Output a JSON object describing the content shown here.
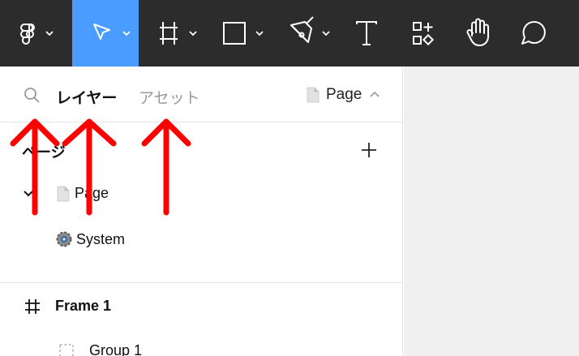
{
  "colors": {
    "toolbar_bg": "#2c2c2c",
    "accent": "#4a9cff",
    "annotation": "#ff0000"
  },
  "toolbar": {
    "items": [
      {
        "name": "figma-menu",
        "icon": "figma-logo-icon",
        "has_chevron": true
      },
      {
        "name": "move-tool",
        "icon": "cursor-icon",
        "has_chevron": true,
        "active": true
      },
      {
        "name": "frame-tool",
        "icon": "frame-hash-icon",
        "has_chevron": true
      },
      {
        "name": "shape-tool",
        "icon": "rectangle-icon",
        "has_chevron": true
      },
      {
        "name": "pen-tool",
        "icon": "pen-nib-icon",
        "has_chevron": true
      },
      {
        "name": "text-tool",
        "icon": "text-t-icon"
      },
      {
        "name": "resources-tool",
        "icon": "components-icon"
      },
      {
        "name": "hand-tool",
        "icon": "hand-icon"
      },
      {
        "name": "comment-tool",
        "icon": "comment-bubble-icon"
      }
    ]
  },
  "panel": {
    "tabs": {
      "layers": "レイヤー",
      "assets": "アセット"
    },
    "page_selector": {
      "label": "Page",
      "icon": "page-file-icon"
    },
    "pages_header": "ページ",
    "pages": [
      {
        "label": "Page",
        "icon": "page-file-icon",
        "expanded": true
      },
      {
        "label": "System",
        "icon": "gear-emoji-icon"
      }
    ],
    "layers": [
      {
        "label": "Frame 1",
        "icon": "frame-hash-icon"
      },
      {
        "label": "Group 1",
        "icon": "group-dashed-icon"
      }
    ]
  },
  "annotations": [
    {
      "type": "arrow-up",
      "target": "search-icon"
    },
    {
      "type": "arrow-up",
      "target": "tab-layers"
    },
    {
      "type": "arrow-up",
      "target": "tab-assets"
    }
  ]
}
